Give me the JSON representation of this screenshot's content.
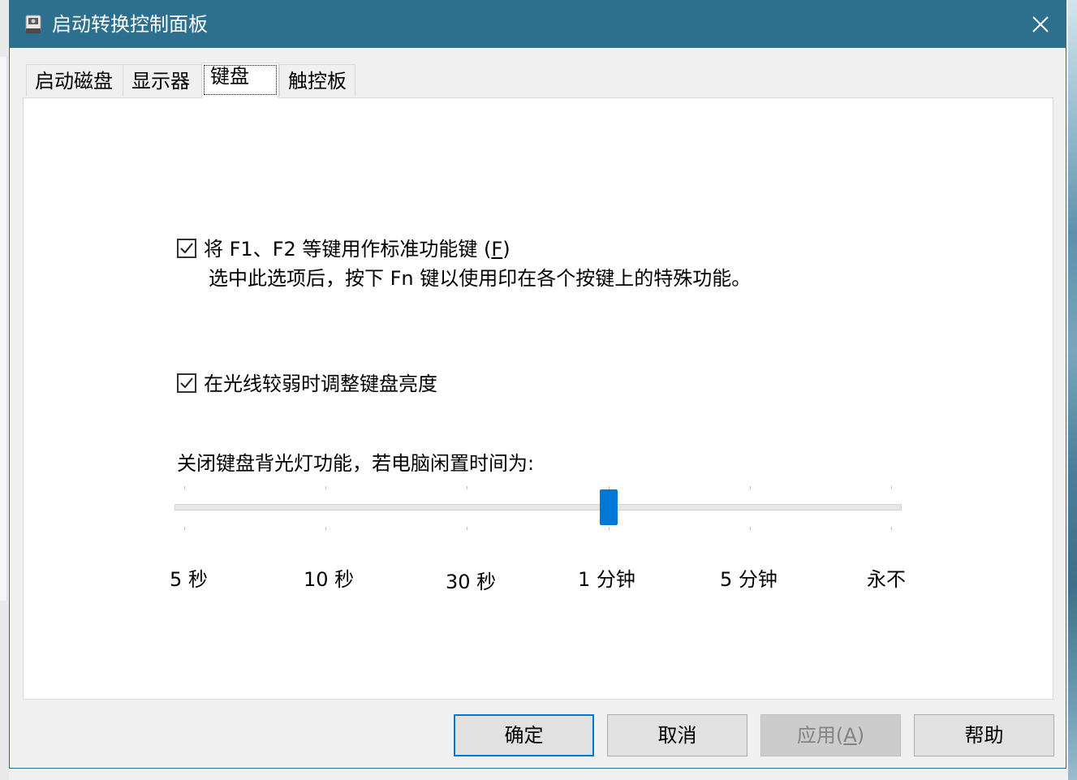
{
  "window": {
    "title": "启动转换控制面板",
    "close_glyph": "✕"
  },
  "tabs": [
    {
      "label": "启动磁盘",
      "active": false
    },
    {
      "label": "显示器",
      "active": false
    },
    {
      "label": "键盘",
      "active": true
    },
    {
      "label": "触控板",
      "active": false
    }
  ],
  "keyboard": {
    "fn_keys": {
      "checked": true,
      "label_prefix": "将 F1、F2 等键用作标准功能键 (",
      "label_accel": "F",
      "label_suffix": ")",
      "description": "选中此选项后，按下 Fn 键以使用印在各个按键上的特殊功能。"
    },
    "adjust_brightness": {
      "checked": true,
      "label": "在光线较弱时调整键盘亮度"
    },
    "backlight": {
      "label": "关闭键盘背光灯功能，若电脑闲置时间为:",
      "ticks": [
        "5 秒",
        "10 秒",
        "30 秒",
        "1 分钟",
        "5 分钟",
        "永不"
      ],
      "selected_index": 3
    }
  },
  "buttons": {
    "ok": "确定",
    "cancel": "取消",
    "apply_prefix": "应用(",
    "apply_accel": "A",
    "apply_suffix": ")",
    "help": "帮助"
  },
  "colors": {
    "titlebar": "#2c6f8e",
    "accent": "#0078d7"
  }
}
